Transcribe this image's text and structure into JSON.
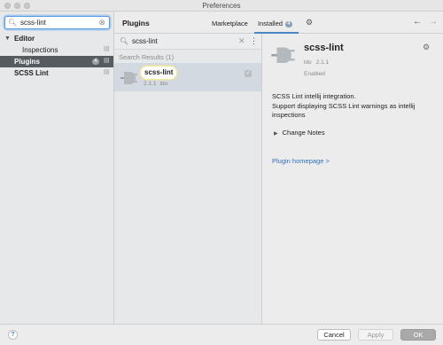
{
  "window": {
    "title": "Preferences"
  },
  "sidebar": {
    "search": {
      "value": "scss-lint",
      "icon": "search-icon"
    },
    "items": [
      {
        "label": "Editor",
        "expanded": true
      },
      {
        "label": "Inspections"
      },
      {
        "label": "Plugins",
        "badge": "4",
        "selected": true
      },
      {
        "label": "SCSS Lint"
      }
    ]
  },
  "plugins_header": {
    "title": "Plugins",
    "tabs": [
      {
        "label": "Marketplace",
        "active": false
      },
      {
        "label": "Installed",
        "count": "4",
        "active": true
      }
    ]
  },
  "list": {
    "search_value": "scss-lint",
    "results_label": "Search Results (1)",
    "items": [
      {
        "name": "scss-lint",
        "version": "2.1.1",
        "vendor": "ldo",
        "enabled": true
      }
    ]
  },
  "detail": {
    "name": "scss-lint",
    "vendor": "ldo",
    "version": "2.1.1",
    "status": "Enabled",
    "description_line1": "SCSS Lint intellij integration.",
    "description_line2": "Support displaying SCSS Lint warnings as intellij inspections",
    "change_notes": "Change Notes",
    "homepage_link": "Plugin homepage >"
  },
  "footer": {
    "help": "?",
    "cancel": "Cancel",
    "apply": "Apply",
    "ok": "OK"
  },
  "colors": {
    "selection": "#565b60",
    "accent": "#4a86c8",
    "link": "#2f6fb7"
  }
}
